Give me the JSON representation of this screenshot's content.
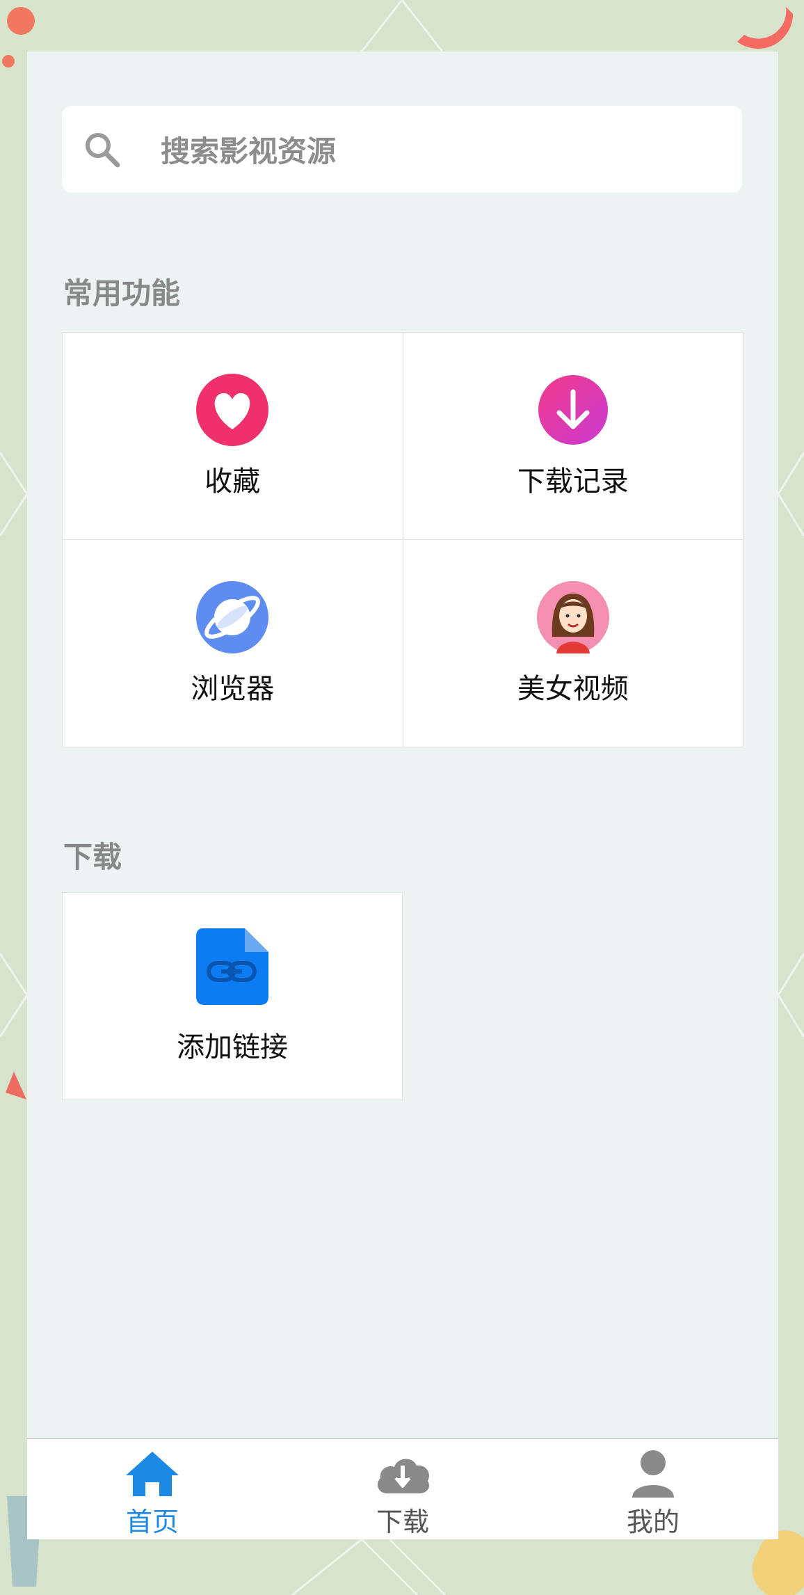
{
  "search": {
    "placeholder": "搜索影视资源"
  },
  "sections": {
    "common_title": "常用功能",
    "download_title": "下载"
  },
  "common_items": [
    {
      "label": "收藏",
      "icon": "heart-icon"
    },
    {
      "label": "下载记录",
      "icon": "download-arrow-icon"
    },
    {
      "label": "浏览器",
      "icon": "planet-browser-icon"
    },
    {
      "label": "美女视频",
      "icon": "girl-avatar-icon"
    }
  ],
  "download_items": [
    {
      "label": "添加链接",
      "icon": "link-file-icon"
    }
  ],
  "tabs": [
    {
      "label": "首页",
      "icon": "home-icon",
      "active": true
    },
    {
      "label": "下载",
      "icon": "cloud-download-icon",
      "active": false
    },
    {
      "label": "我的",
      "icon": "user-icon",
      "active": false
    }
  ],
  "colors": {
    "accent": "#1e88e5",
    "heart": "#f0306a",
    "download": "#e63bb0",
    "browser": "#5e8cf0",
    "link_file": "#0d7cf2"
  }
}
